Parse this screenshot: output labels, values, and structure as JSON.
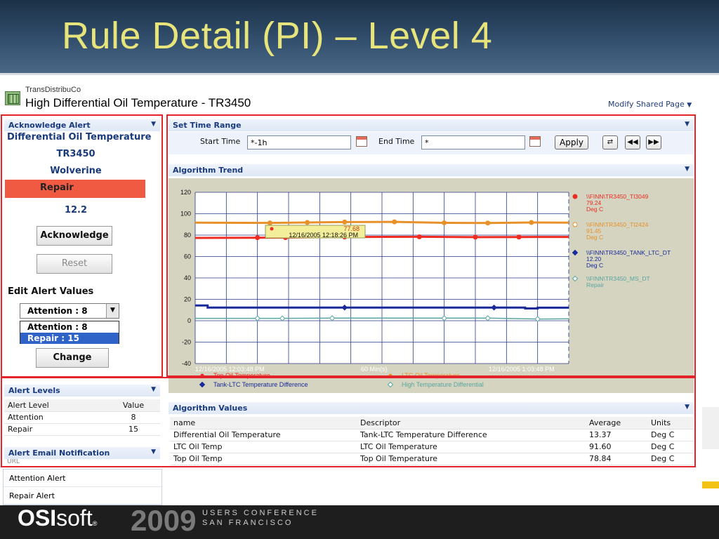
{
  "slide": {
    "title": "Rule Detail (PI) – Level 4",
    "footer": {
      "brand_bold": "OSI",
      "brand_rest": "soft",
      "brand_mark": "®",
      "year": "2009",
      "conf_line1": "USERS CONFERENCE",
      "conf_line2": "SAN FRANCISCO"
    }
  },
  "app": {
    "company": "TransDistribuCo",
    "title": "High Differential Oil Temperature - TR3450",
    "modify_link": "Modify Shared Page"
  },
  "acknowledge": {
    "header": "Acknowledge Alert",
    "rule_name": "Differential Oil Temperature",
    "asset": "TR3450",
    "location": "Wolverine",
    "status": "Repair",
    "value": "12.2",
    "acknowledge_label": "Acknowledge",
    "reset_label": "Reset",
    "edit_label": "Edit Alert Values",
    "select_value": "Attention : 8",
    "options": [
      "Attention : 8",
      "Repair : 15"
    ],
    "change_label": "Change"
  },
  "alert_levels": {
    "header": "Alert Levels",
    "columns": [
      "Alert Level",
      "Value"
    ],
    "rows": [
      [
        "Attention",
        "8"
      ],
      [
        "Repair",
        "15"
      ]
    ]
  },
  "email": {
    "header": "Alert Email Notification",
    "url_label": "URL",
    "items": [
      "Attention Alert",
      "Repair Alert"
    ]
  },
  "time_range": {
    "header": "Set Time Range",
    "start_label": "Start Time",
    "start_value": "*-1h",
    "end_label": "End Time",
    "end_value": "*",
    "apply_label": "Apply"
  },
  "trend": {
    "header": "Algorithm Trend",
    "cursor_value": "77.68",
    "cursor_time": "12/16/2005 12:18:26 PM",
    "start_time": "12/16/2005 12:03:48 PM",
    "span": "60 Min(s)",
    "end_time": "12/16/2005 1:03:48 PM"
  },
  "chart_data": {
    "type": "line",
    "ylim": [
      -40,
      120
    ],
    "y_ticks": [
      -40,
      -20,
      0,
      20,
      40,
      60,
      80,
      100,
      120
    ],
    "x_minutes": [
      0,
      60
    ],
    "series": [
      {
        "name": "Top Oil Temperature",
        "tag": "\\\\FINN\\TR3450_TI3049",
        "value": "79.24",
        "units": "Deg C",
        "color": "#ef2c22",
        "marker": "circle",
        "points": [
          [
            0,
            77.4
          ],
          [
            10,
            77.6
          ],
          [
            14.5,
            77.68
          ],
          [
            24,
            78.3
          ],
          [
            36,
            78.4
          ],
          [
            45,
            78.1
          ],
          [
            52,
            78.2
          ],
          [
            60,
            78.3
          ]
        ]
      },
      {
        "name": "LTC Oil Temperature",
        "tag": "\\\\FINN\\TR3450_TI2424",
        "value": "91.45",
        "units": "Deg C",
        "color": "#e8912a",
        "marker": "circle",
        "points": [
          [
            0,
            91.6
          ],
          [
            12,
            91.4
          ],
          [
            18,
            91.8
          ],
          [
            24,
            92.2
          ],
          [
            32,
            92.4
          ],
          [
            40,
            91.5
          ],
          [
            47,
            91.3
          ],
          [
            54,
            91.8
          ],
          [
            60,
            91.6
          ]
        ]
      },
      {
        "name": "Tank-LTC Temperature Difference",
        "tag": "\\\\FINN\\TR3450_TANK_LTC_DT",
        "value": "12.20",
        "units": "Deg C",
        "color": "#1a2a9a",
        "marker": "diamond",
        "points": [
          [
            0,
            14.2
          ],
          [
            2,
            14.2
          ],
          [
            2,
            12.3
          ],
          [
            24,
            12.3
          ],
          [
            48,
            12.3
          ],
          [
            53,
            12.3
          ],
          [
            53,
            11.5
          ],
          [
            55,
            11.5
          ],
          [
            55,
            12.2
          ],
          [
            60,
            12.2
          ]
        ]
      },
      {
        "name": "High Temperature Differential",
        "tag": "\\\\FINN\\TR3450_MS_DT",
        "value": "Repair",
        "units": "",
        "color": "#5aa6a0",
        "marker": "diamond-open",
        "points": [
          [
            0,
            2.2
          ],
          [
            10,
            2.2
          ],
          [
            14,
            2.2
          ],
          [
            22,
            2.4
          ],
          [
            40,
            2.4
          ],
          [
            47,
            2.4
          ],
          [
            55,
            1.6
          ],
          [
            60,
            1.8
          ]
        ]
      }
    ]
  },
  "algorithm_values": {
    "header": "Algorithm Values",
    "columns": [
      "name",
      "Descriptor",
      "Average",
      "Units"
    ],
    "rows": [
      [
        "Differential Oil Temperature",
        "Tank-LTC Temperature Difference",
        "13.37",
        "Deg C"
      ],
      [
        "LTC Oil Temp",
        "LTC Oil Temperature",
        "91.60",
        "Deg C"
      ],
      [
        "Top Oil Temp",
        "Top Oil Temperature",
        "78.84",
        "Deg C"
      ]
    ]
  }
}
